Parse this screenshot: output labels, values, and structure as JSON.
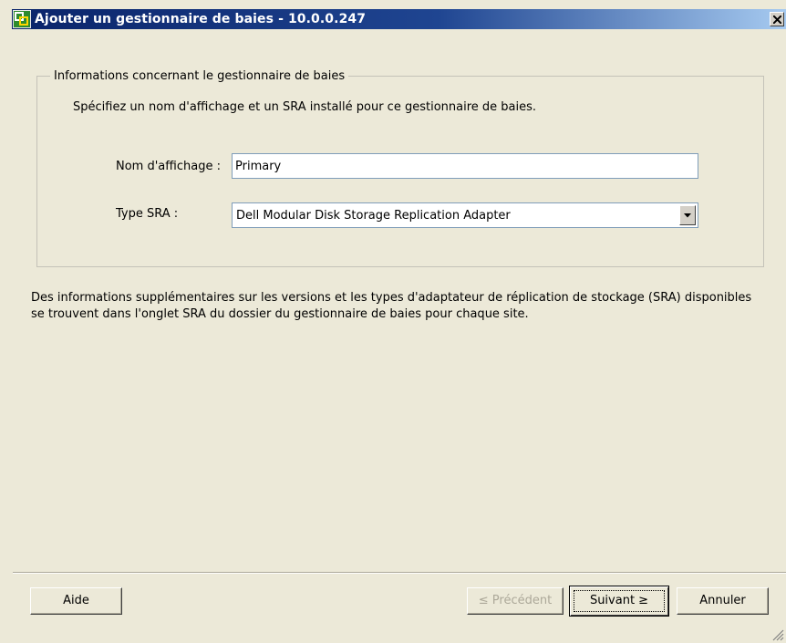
{
  "window": {
    "title": "Ajouter un gestionnaire de baies - 10.0.0.247",
    "app_icon": "vmware-icon",
    "close_icon": "close-icon"
  },
  "group": {
    "legend": "Informations concernant le gestionnaire de baies",
    "description": "Spécifiez un nom d'affichage et un SRA installé pour ce gestionnaire de baies."
  },
  "form": {
    "name_label": "Nom d'affichage :",
    "name_value": "Primary",
    "type_label": "Type SRA :",
    "type_value": "Dell Modular Disk Storage Replication Adapter"
  },
  "info": {
    "text": "Des informations supplémentaires sur les versions et les types d'adaptateur de réplication de stockage (SRA) disponibles se trouvent dans l'onglet SRA du dossier du gestionnaire de baies pour chaque site."
  },
  "buttons": {
    "help_label": "Aide",
    "prev_label": "≤ Précédent",
    "next_label": "Suivant ≥",
    "cancel_label": "Annuler"
  }
}
